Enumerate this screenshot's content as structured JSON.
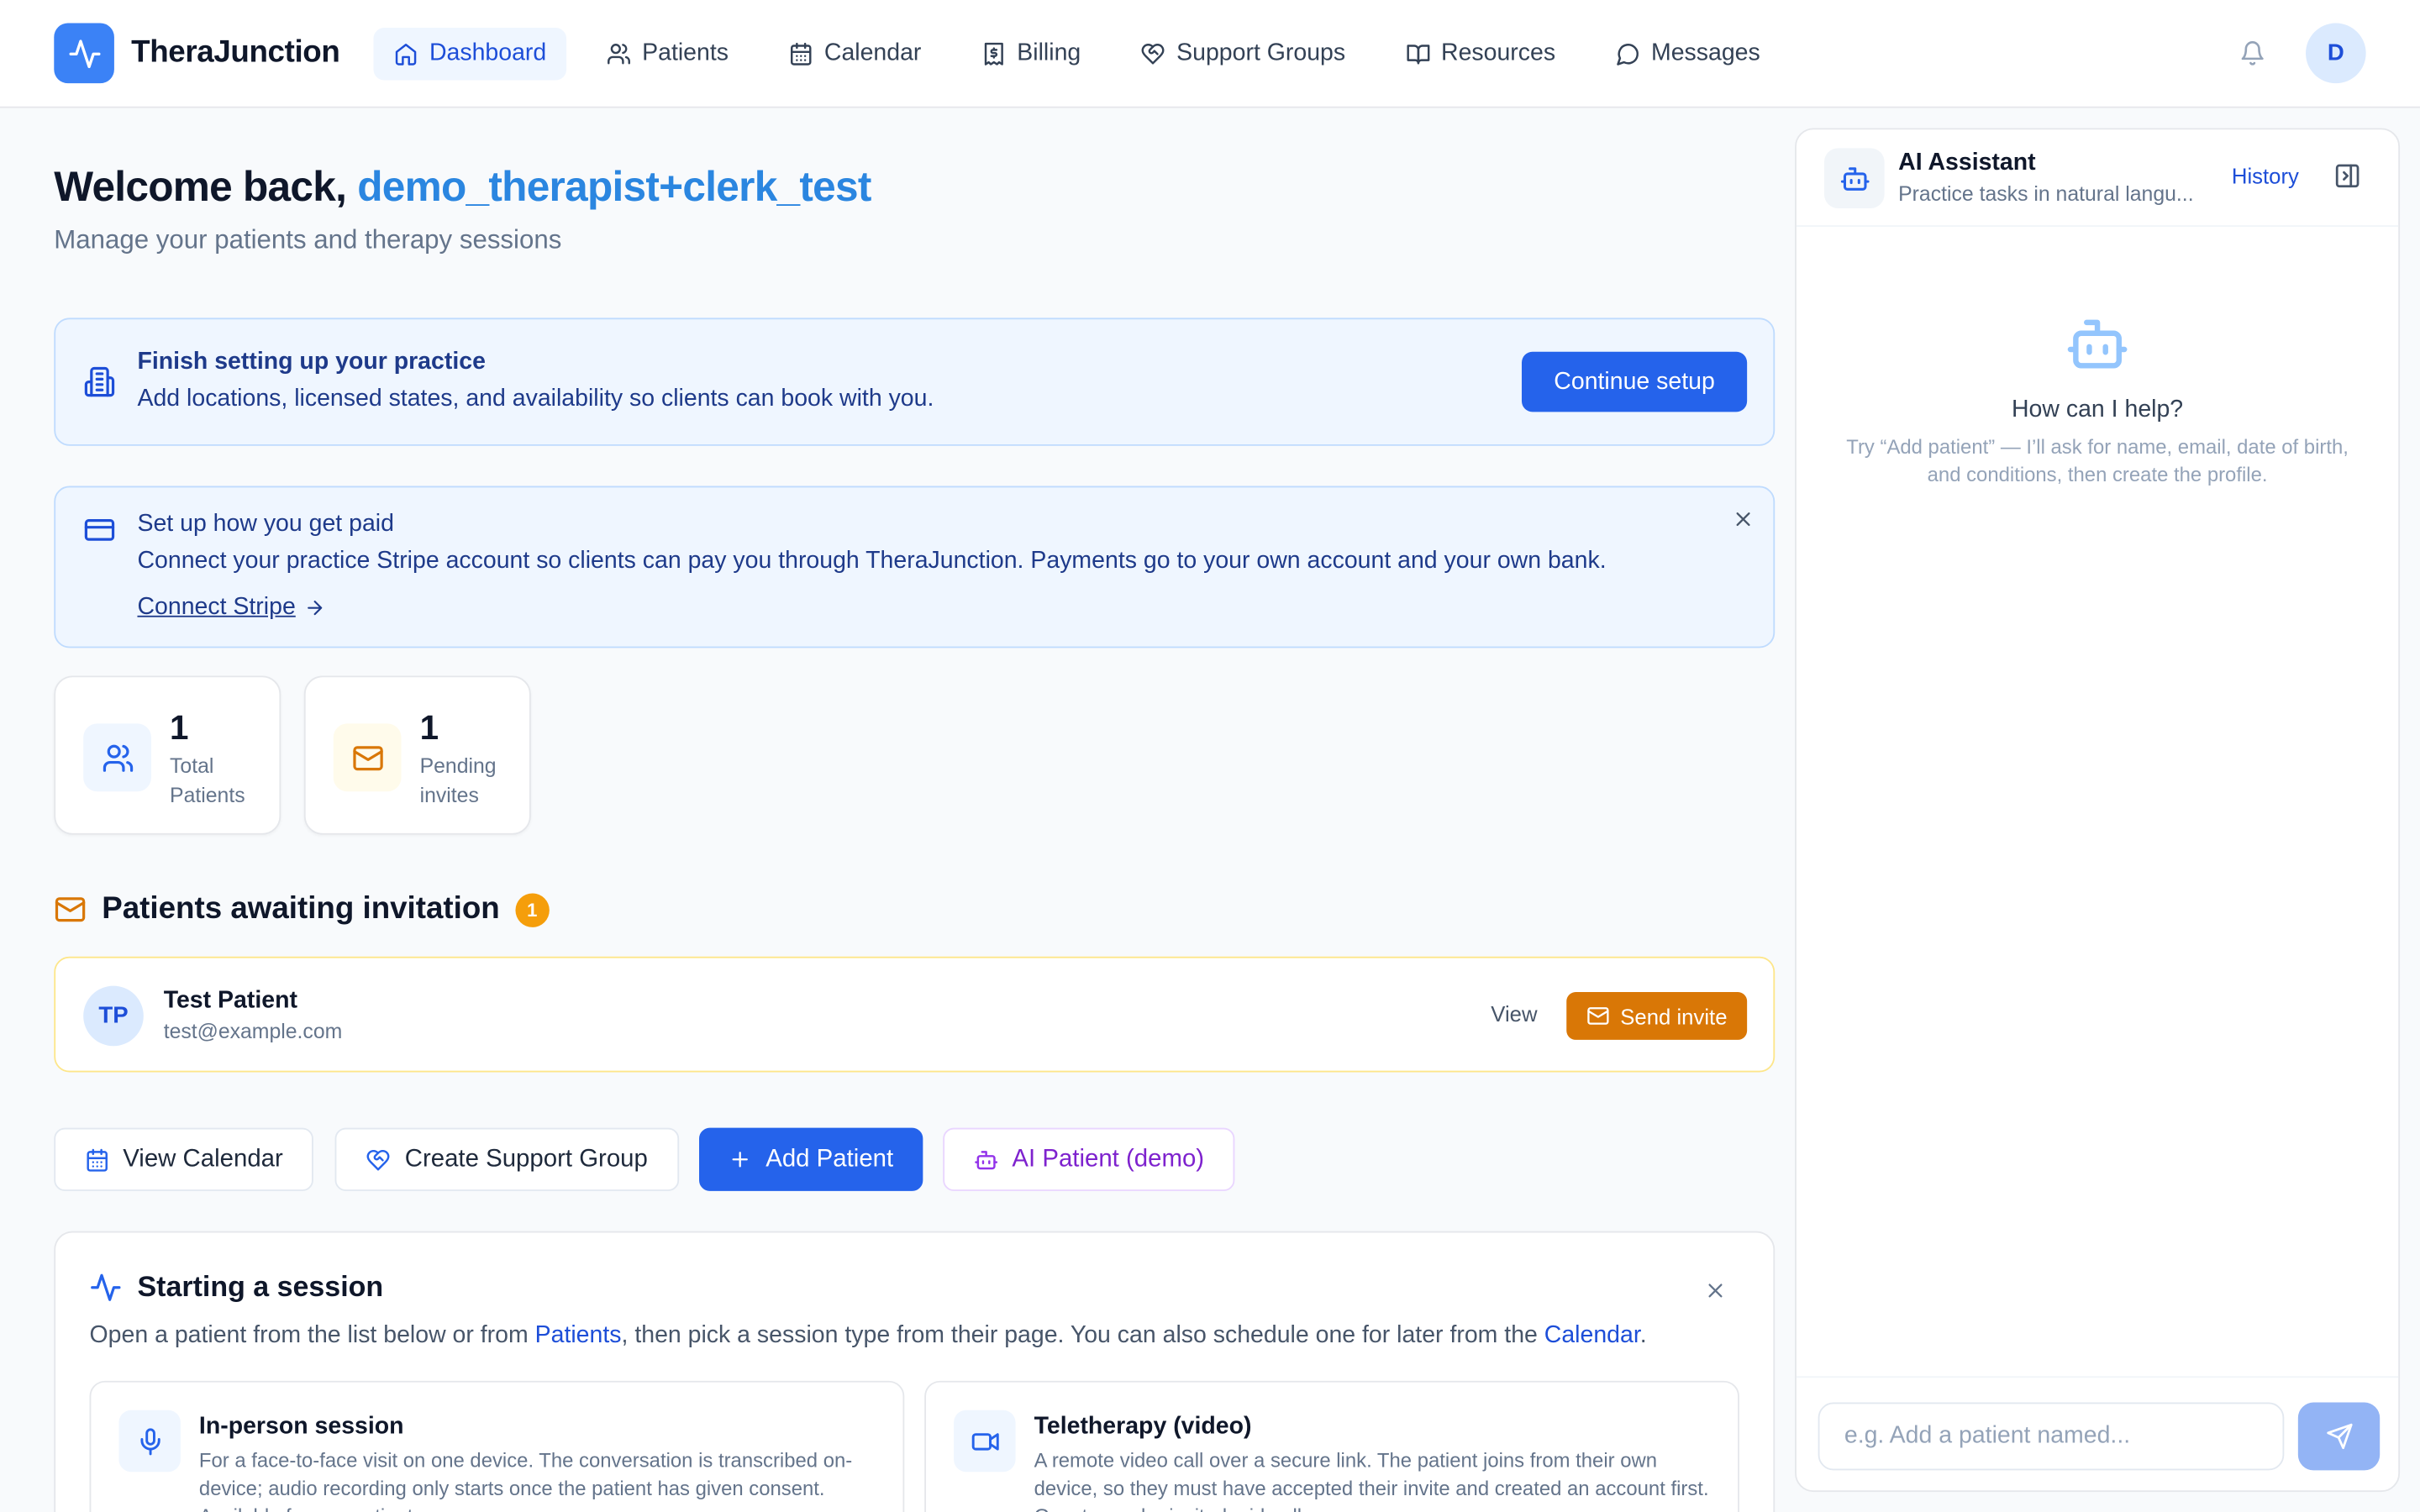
{
  "app": {
    "name": "TheraJunction"
  },
  "nav": {
    "items": [
      {
        "label": "Dashboard",
        "icon": "home-icon",
        "active": true
      },
      {
        "label": "Patients",
        "icon": "users-icon"
      },
      {
        "label": "Calendar",
        "icon": "calendar-icon"
      },
      {
        "label": "Billing",
        "icon": "billing-icon"
      },
      {
        "label": "Support Groups",
        "icon": "heart-handshake-icon"
      },
      {
        "label": "Resources",
        "icon": "book-icon"
      },
      {
        "label": "Messages",
        "icon": "message-icon"
      }
    ],
    "avatar_initial": "D"
  },
  "welcome": {
    "prefix": "Welcome back, ",
    "username": "demo_therapist+clerk_test",
    "subtitle": "Manage your patients and therapy sessions"
  },
  "setup_banner": {
    "title": "Finish setting up your practice",
    "text": "Add locations, licensed states, and availability so clients can book with you.",
    "button": "Continue setup"
  },
  "payment_banner": {
    "title": "Set up how you get paid",
    "text": "Connect your practice Stripe account so clients can pay you through TheraJunction. Payments go to your own account and your own bank.",
    "link": "Connect Stripe"
  },
  "stats": [
    {
      "value": "1",
      "label": "Total Patients"
    },
    {
      "value": "1",
      "label": "Pending invites"
    }
  ],
  "awaiting": {
    "title": "Patients awaiting invitation",
    "count": "1",
    "patient": {
      "initials": "TP",
      "name": "Test Patient",
      "email": "test@example.com",
      "view_label": "View",
      "send_label": "Send invite"
    }
  },
  "actions": {
    "view_calendar": "View Calendar",
    "create_group": "Create Support Group",
    "add_patient": "Add Patient",
    "ai_patient": "AI Patient (demo)"
  },
  "session": {
    "title": "Starting a session",
    "desc_a": "Open a patient from the list below or from ",
    "desc_link1": "Patients",
    "desc_b": ", then pick a session type from their page. You can also schedule one for later from the ",
    "desc_link2": "Calendar",
    "desc_c": ".",
    "in_person": {
      "title": "In-person session",
      "text": "For a face-to-face visit on one device. The conversation is transcribed on-device; audio recording only starts once the patient has given consent. Available for any patient."
    },
    "teletherapy": {
      "title": "Teletherapy (video)",
      "text": "A remote video call over a secure link. The patient joins from their own device, so they must have accepted their invite and created an account first. Guests can be invited mid-call."
    }
  },
  "ai": {
    "title": "AI Assistant",
    "subtitle": "Practice tasks in natural langu...",
    "history": "History",
    "help_title": "How can I help?",
    "hint": "Try “Add patient” — I’ll ask for name, email, date of birth, and conditions, then create the profile.",
    "placeholder": "e.g. Add a patient named..."
  }
}
